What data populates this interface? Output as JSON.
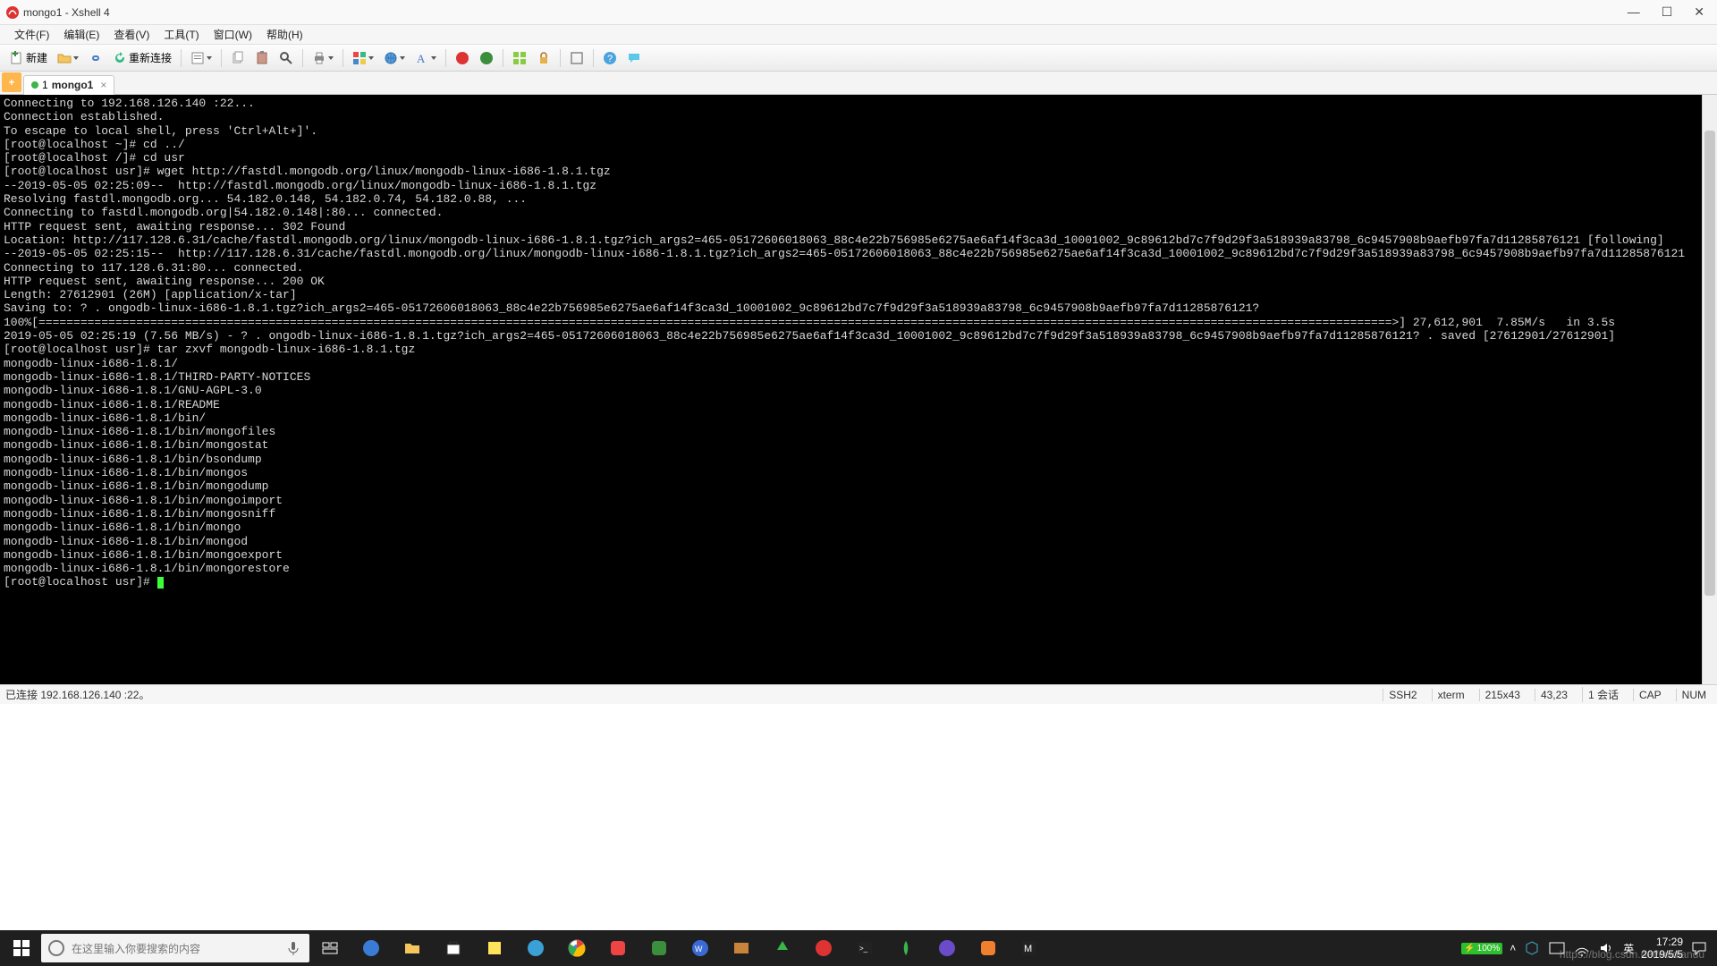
{
  "window": {
    "title": "mongo1 - Xshell 4",
    "controls": {
      "min": "—",
      "max": "☐",
      "close": "✕"
    }
  },
  "menu": {
    "file": "文件(F)",
    "edit": "编辑(E)",
    "view": "查看(V)",
    "tools": "工具(T)",
    "window": "窗口(W)",
    "help": "帮助(H)"
  },
  "toolbar": {
    "new_label": "新建",
    "reconnect_label": "重新连接"
  },
  "tabs": {
    "plus": "+",
    "active": {
      "index": "1",
      "name": "mongo1",
      "close": "×"
    }
  },
  "terminal": {
    "lines": [
      "Connecting to 192.168.126.140 :22...",
      "Connection established.",
      "To escape to local shell, press 'Ctrl+Alt+]'.",
      "",
      "[root@localhost ~]# cd ../",
      "[root@localhost /]# cd usr",
      "[root@localhost usr]# wget http://fastdl.mongodb.org/linux/mongodb-linux-i686-1.8.1.tgz",
      "--2019-05-05 02:25:09--  http://fastdl.mongodb.org/linux/mongodb-linux-i686-1.8.1.tgz",
      "Resolving fastdl.mongodb.org... 54.182.0.148, 54.182.0.74, 54.182.0.88, ...",
      "Connecting to fastdl.mongodb.org|54.182.0.148|:80... connected.",
      "HTTP request sent, awaiting response... 302 Found",
      "Location: http://117.128.6.31/cache/fastdl.mongodb.org/linux/mongodb-linux-i686-1.8.1.tgz?ich_args2=465-05172606018063_88c4e22b756985e6275ae6af14f3ca3d_10001002_9c89612bd7c7f9d29f3a518939a83798_6c9457908b9aefb97fa7d11285876121 [following]",
      "--2019-05-05 02:25:15--  http://117.128.6.31/cache/fastdl.mongodb.org/linux/mongodb-linux-i686-1.8.1.tgz?ich_args2=465-05172606018063_88c4e22b756985e6275ae6af14f3ca3d_10001002_9c89612bd7c7f9d29f3a518939a83798_6c9457908b9aefb97fa7d11285876121",
      "Connecting to 117.128.6.31:80... connected.",
      "HTTP request sent, awaiting response... 200 OK",
      "Length: 27612901 (26M) [application/x-tar]",
      "Saving to: ? . ongodb-linux-i686-1.8.1.tgz?ich_args2=465-05172606018063_88c4e22b756985e6275ae6af14f3ca3d_10001002_9c89612bd7c7f9d29f3a518939a83798_6c9457908b9aefb97fa7d11285876121?",
      "",
      "100%[==================================================================================================================================================================================================>] 27,612,901  7.85M/s   in 3.5s",
      "",
      "2019-05-05 02:25:19 (7.56 MB/s) - ? . ongodb-linux-i686-1.8.1.tgz?ich_args2=465-05172606018063_88c4e22b756985e6275ae6af14f3ca3d_10001002_9c89612bd7c7f9d29f3a518939a83798_6c9457908b9aefb97fa7d11285876121? . saved [27612901/27612901]",
      "",
      "[root@localhost usr]# tar zxvf mongodb-linux-i686-1.8.1.tgz",
      "mongodb-linux-i686-1.8.1/",
      "mongodb-linux-i686-1.8.1/THIRD-PARTY-NOTICES",
      "mongodb-linux-i686-1.8.1/GNU-AGPL-3.0",
      "mongodb-linux-i686-1.8.1/README",
      "mongodb-linux-i686-1.8.1/bin/",
      "mongodb-linux-i686-1.8.1/bin/mongofiles",
      "mongodb-linux-i686-1.8.1/bin/mongostat",
      "mongodb-linux-i686-1.8.1/bin/bsondump",
      "mongodb-linux-i686-1.8.1/bin/mongos",
      "mongodb-linux-i686-1.8.1/bin/mongodump",
      "mongodb-linux-i686-1.8.1/bin/mongoimport",
      "mongodb-linux-i686-1.8.1/bin/mongosniff",
      "mongodb-linux-i686-1.8.1/bin/mongo",
      "mongodb-linux-i686-1.8.1/bin/mongod",
      "mongodb-linux-i686-1.8.1/bin/mongoexport",
      "mongodb-linux-i686-1.8.1/bin/mongorestore"
    ],
    "prompt": "[root@localhost usr]# "
  },
  "status": {
    "left": "已连接 192.168.126.140 :22。",
    "ssh": "SSH2",
    "term": "xterm",
    "size": "215x43",
    "pos": "43,23",
    "sess": "1 会话",
    "cap": "CAP",
    "num": "NUM"
  },
  "taskbar": {
    "search_placeholder": "在这里输入你要搜索的内容",
    "battery": "100%",
    "time": "17:29",
    "date": "2019/5/5"
  },
  "watermark": "https://blog.csdn.net/caidiandu",
  "colors": {
    "terminal_bg": "#000000",
    "terminal_fg": "#d7d7d7",
    "cursor": "#3bff3b",
    "tab_indicator": "#3bb54a"
  }
}
